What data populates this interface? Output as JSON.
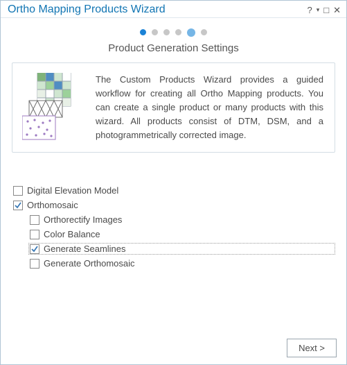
{
  "window": {
    "title": "Ortho Mapping Products Wizard"
  },
  "stepper": {
    "total": 6,
    "active_index": 0,
    "preview_index": 4
  },
  "subtitle": "Product Generation Settings",
  "info_text": "The Custom Products Wizard provides a guided workflow for creating all Ortho Mapping products. You can create a single product or many products with this wizard.  All products consist of DTM, DSM, and a photogrammetrically corrected image.",
  "options": {
    "dem": {
      "label": "Digital Elevation Model",
      "checked": false
    },
    "ortho": {
      "label": "Orthomosaic",
      "checked": true
    },
    "sub": {
      "orthorectify": {
        "label": "Orthorectify Images",
        "checked": false
      },
      "color_balance": {
        "label": "Color Balance",
        "checked": false
      },
      "seamlines": {
        "label": "Generate Seamlines",
        "checked": true
      },
      "gen_ortho": {
        "label": "Generate Orthomosaic",
        "checked": false
      }
    }
  },
  "footer": {
    "next_label": "Next >"
  }
}
